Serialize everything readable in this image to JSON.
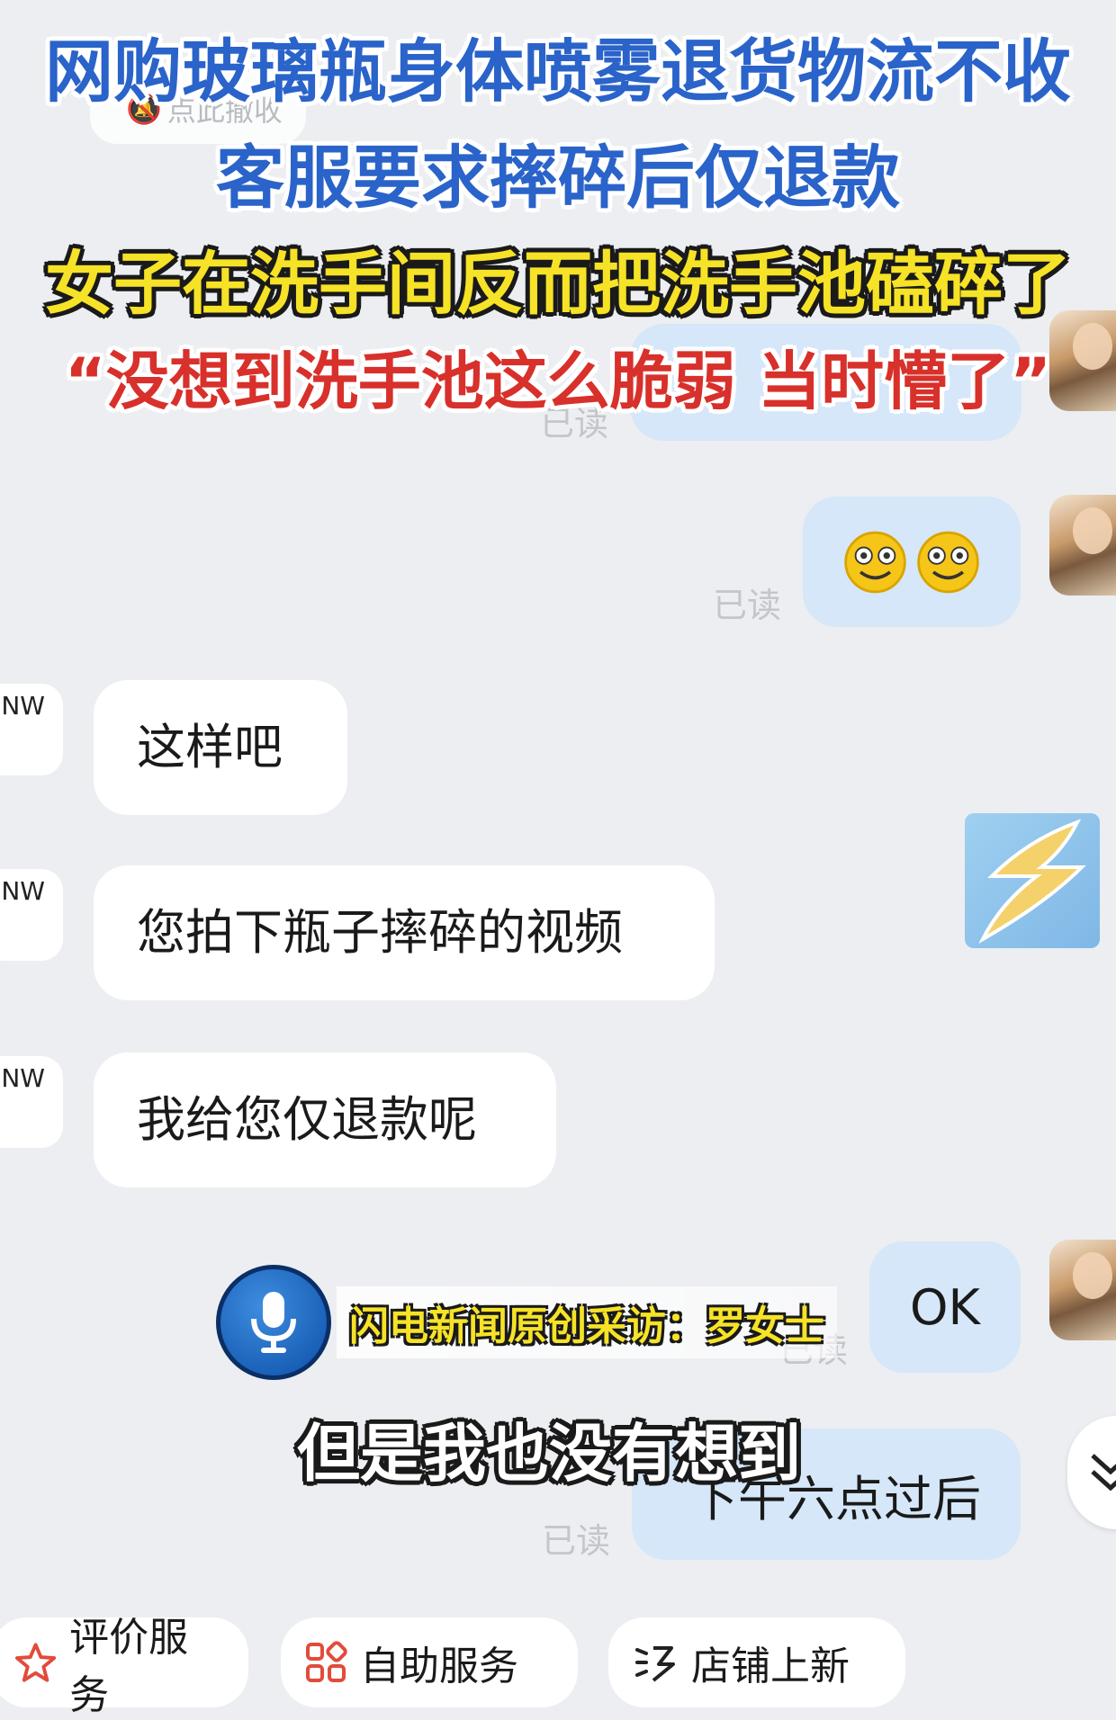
{
  "overlay": {
    "line1": "网购玻璃瓶身体喷雾退货物流不收",
    "line2": "客服要求摔碎后仅退款",
    "line3": "女子在洗手间反而把洗手池磕碎了",
    "line4": "“没想到洗手池这么脆弱 当时懵了”",
    "recall_hint": "点此撤收",
    "interview_label": "闪电新闻原创采访：罗女士",
    "subtitle": "但是我也没有想到"
  },
  "messages": {
    "read_label": "已读",
    "seller_avatar_text": "NW",
    "seller_1": "这样吧",
    "seller_2": "您拍下瓶子摔碎的视频",
    "seller_3": "我给您仅退款呢",
    "user_ok": "OK",
    "user_last": "下午六点过后"
  },
  "bottom_bar": {
    "btn1": "评价服务",
    "btn2": "自助服务",
    "btn3": "店铺上新"
  },
  "colors": {
    "bg": "#eceef1",
    "bubble_out": "#d5e7f8",
    "bubble_in": "#ffffff",
    "headline_blue": "#2a63c9",
    "headline_yellow": "#f6e227",
    "headline_red": "#d8302b"
  }
}
